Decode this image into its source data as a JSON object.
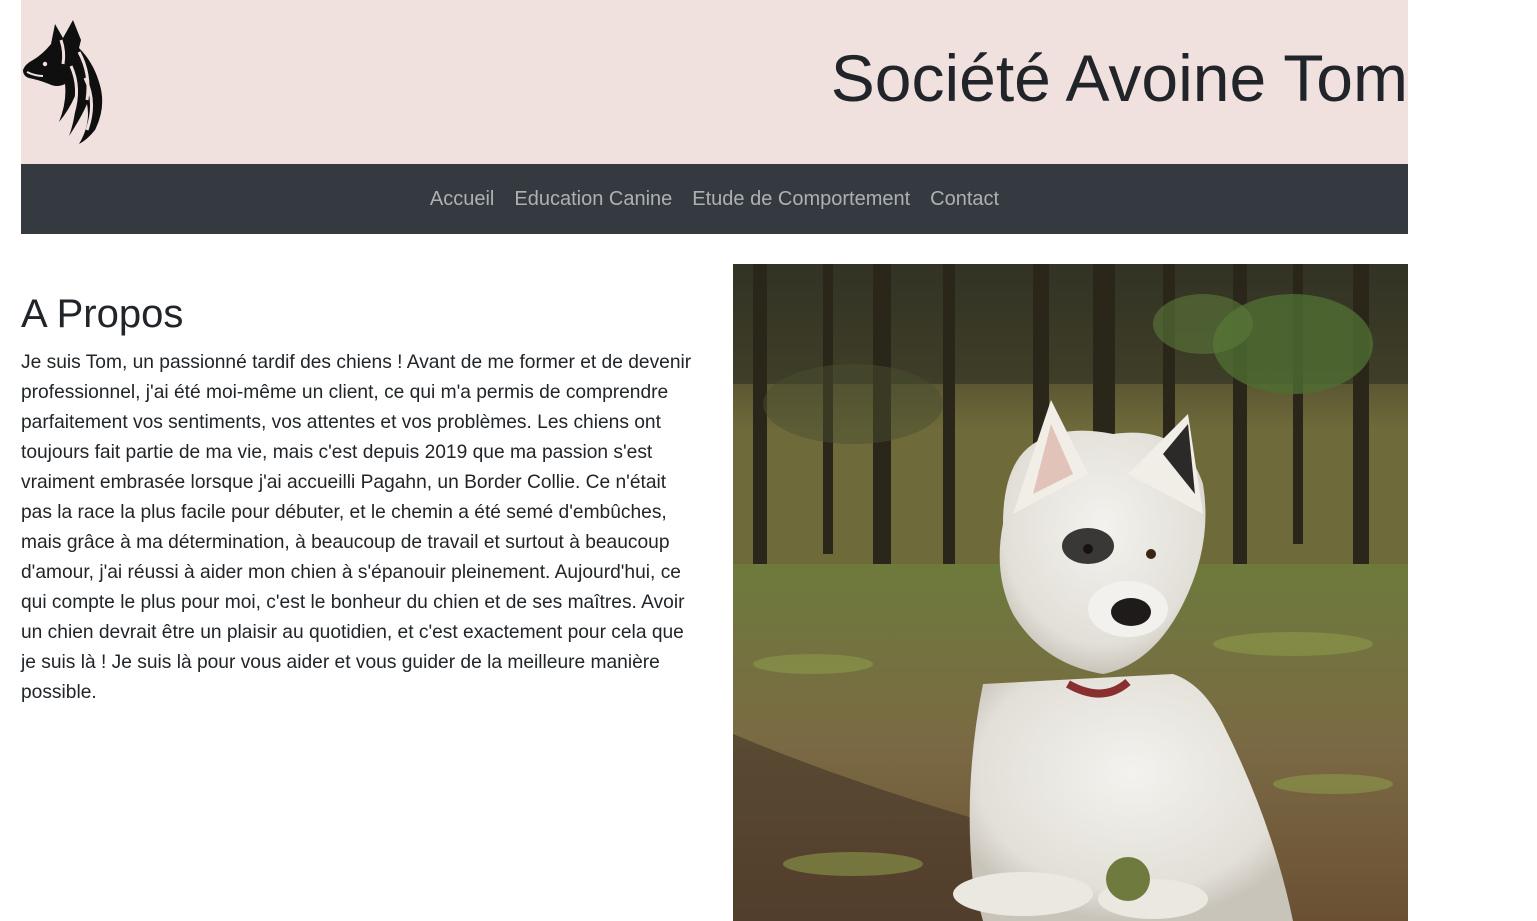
{
  "header": {
    "site_title": "Société Avoine Tom",
    "logo_icon": "wolf-dog-head-logo"
  },
  "nav": {
    "items": [
      {
        "label": "Accueil"
      },
      {
        "label": "Education Canine"
      },
      {
        "label": "Etude de Comportement"
      },
      {
        "label": "Contact"
      }
    ]
  },
  "about": {
    "title": "A Propos",
    "paragraph": "Je suis Tom, un passionné tardif des chiens ! Avant de me former et de devenir professionnel, j'ai été moi-même un client, ce qui m'a permis de comprendre parfaitement vos sentiments, vos attentes et vos problèmes. Les chiens ont toujours fait partie de ma vie, mais c'est depuis 2019 que ma passion s'est vraiment embrasée lorsque j'ai accueilli Pagahn, un Border Collie. Ce n'était pas la race la plus facile pour débuter, et le chemin a été semé d'embûches, mais grâce à ma détermination, à beaucoup de travail et surtout à beaucoup d'amour, j'ai réussi à aider mon chien à s'épanouir pleinement. Aujourd'hui, ce qui compte le plus pour moi, c'est le bonheur du chien et de ses maîtres. Avoir un chien devrait être un plaisir au quotidien, et c'est exactement pour cela que je suis là ! Je suis là pour vous aider et vous guider de la meilleure manière possible."
  },
  "colors": {
    "header_bg": "#f0e1df",
    "navbar_bg": "#343a40",
    "nav_link": "rgba(255,255,255,0.6)",
    "text": "#212529"
  }
}
